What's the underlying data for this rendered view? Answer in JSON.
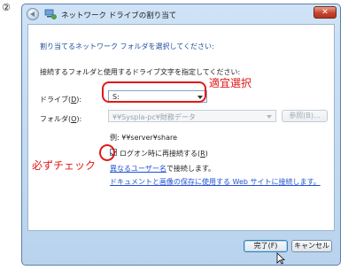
{
  "step_marker": "②",
  "window": {
    "title": "ネットワーク ドライブの割り当て",
    "close_glyph": "✕"
  },
  "content": {
    "heading": "割り当てるネットワーク フォルダを選択してください:",
    "instruction": "接続するフォルダと使用するドライブ文字を指定してください:",
    "drive_label": "ドライブ(",
    "drive_accel": "D",
    "drive_label_end": "):",
    "drive_value": "S:",
    "folder_label": "フォルダ(",
    "folder_accel": "O",
    "folder_label_end": "):",
    "folder_value": "¥¥Syspla-pc¥財務データ",
    "browse_label": "参照(B)...",
    "example": "例: ¥¥server¥share",
    "reconnect_label": "ログオン時に再接続する(",
    "reconnect_accel": "R",
    "reconnect_label_end": ")",
    "reconnect_checked": true,
    "other_user_link": "異なるユーザー名",
    "other_user_suffix": "で接続します。",
    "web_link": "ドキュメントと画像の保存に使用する Web サイトに接続します。"
  },
  "footer": {
    "finish_label": "完了(F)",
    "cancel_label": "キャンセル"
  },
  "annotations": {
    "select_note": "適宜選択",
    "check_note": "必ずチェック",
    "color": "#e01818"
  }
}
